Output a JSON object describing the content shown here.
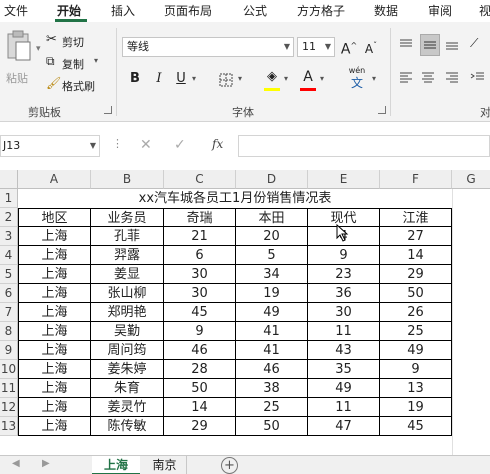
{
  "ribbon_tabs": [
    "文件",
    "开始",
    "插入",
    "页面布局",
    "公式",
    "方方格子",
    "数据",
    "审阅",
    "视"
  ],
  "active_tab": "开始",
  "clipboard": {
    "paste": "粘贴",
    "cut": "剪切",
    "copy": "复制",
    "format_painter": "格式刷",
    "group": "剪贴板"
  },
  "font": {
    "name": "等线",
    "size": "11",
    "grow": "A",
    "shrink": "A",
    "bold": "B",
    "italic": "I",
    "underline": "U",
    "wen": "wén",
    "wen_char": "文",
    "group": "字体"
  },
  "alignment": {
    "group": "对"
  },
  "name_box": "J13",
  "fx": "fx",
  "columns": [
    "A",
    "B",
    "C",
    "D",
    "E",
    "F",
    "G"
  ],
  "rows": [
    "1",
    "2",
    "3",
    "4",
    "5",
    "6",
    "7",
    "8",
    "9",
    "10",
    "11",
    "12",
    "13"
  ],
  "sheet_title": "xx汽车城各员工1月份销售情况表",
  "headers": [
    "地区",
    "业务员",
    "奇瑞",
    "本田",
    "现代",
    "江淮"
  ],
  "table": [
    [
      "上海",
      "孔菲",
      "21",
      "20",
      "4",
      "27"
    ],
    [
      "上海",
      "羿露",
      "6",
      "5",
      "9",
      "14"
    ],
    [
      "上海",
      "姜显",
      "30",
      "34",
      "23",
      "29"
    ],
    [
      "上海",
      "张山柳",
      "30",
      "19",
      "36",
      "50"
    ],
    [
      "上海",
      "郑明艳",
      "45",
      "49",
      "30",
      "26"
    ],
    [
      "上海",
      "吴勤",
      "9",
      "41",
      "11",
      "25"
    ],
    [
      "上海",
      "周问筠",
      "46",
      "41",
      "43",
      "49"
    ],
    [
      "上海",
      "姜朱婷",
      "28",
      "46",
      "35",
      "9"
    ],
    [
      "上海",
      "朱育",
      "50",
      "38",
      "49",
      "13"
    ],
    [
      "上海",
      "姜灵竹",
      "14",
      "25",
      "11",
      "19"
    ],
    [
      "上海",
      "陈传敏",
      "29",
      "50",
      "47",
      "45"
    ]
  ],
  "sheets": [
    "上海",
    "南京"
  ],
  "active_sheet": "上海",
  "colors": {
    "accent": "#217346"
  }
}
